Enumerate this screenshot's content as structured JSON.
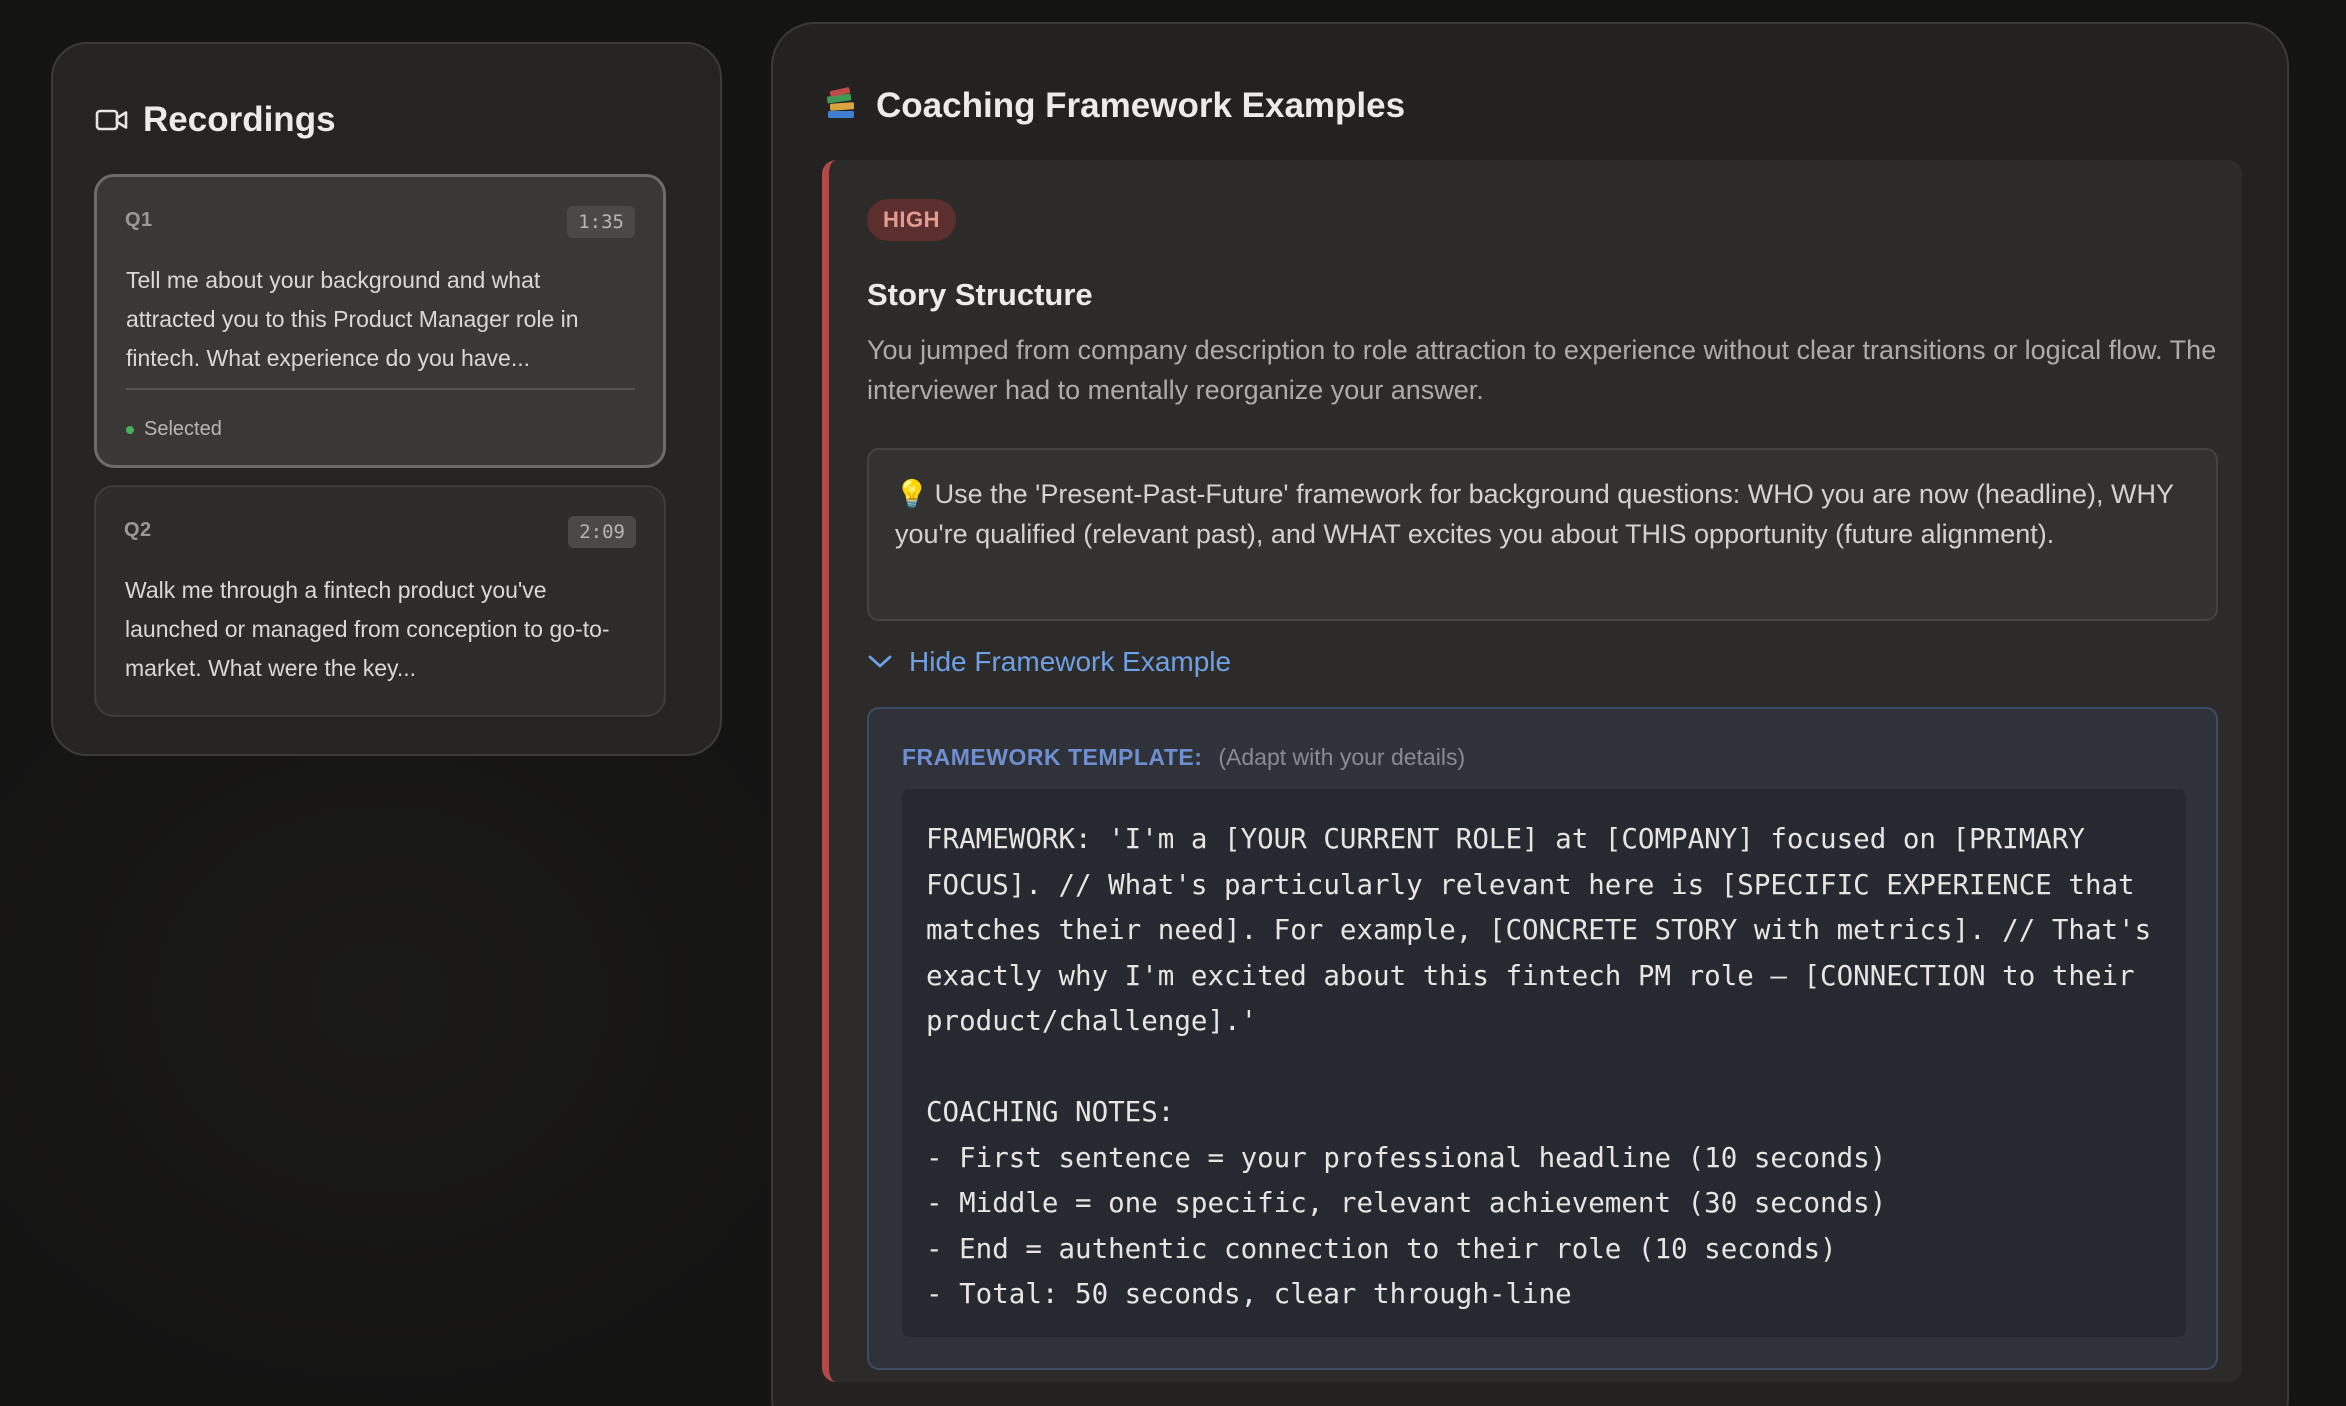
{
  "recordings": {
    "title": "Recordings",
    "icon": "video-camera-icon",
    "items": [
      {
        "label": "Q1",
        "duration": "1:35",
        "text": "Tell me about your background and what attracted you to this Product Manager role in fintech. What experience do you have...",
        "status": "Selected"
      },
      {
        "label": "Q2",
        "duration": "2:09",
        "text": "Walk me through a fintech product you've launched or managed from conception to go-to-market. What were the key..."
      }
    ]
  },
  "coaching": {
    "title": "Coaching Framework Examples",
    "icon": "books-icon",
    "feedback": {
      "severity": "HIGH",
      "severity_color": "#b04a4a",
      "title": "Story Structure",
      "description": "You jumped from company description to role attraction to experience without clear transitions or logical flow. The interviewer had to mentally reorganize your answer.",
      "tip": "Use the 'Present-Past-Future' framework for background questions: WHO you are now (headline), WHY you're qualified (relevant past), and WHAT excites you about THIS opportunity (future alignment).",
      "toggle_label": "Hide Framework Example",
      "framework_label": "FRAMEWORK TEMPLATE:",
      "framework_hint": "(Adapt with your details)",
      "framework_text": "FRAMEWORK: 'I'm a [YOUR CURRENT ROLE] at [COMPANY] focused on [PRIMARY FOCUS]. // What's particularly relevant here is [SPECIFIC EXPERIENCE that matches their need]. For example, [CONCRETE STORY with metrics]. // That's exactly why I'm excited about this fintech PM role — [CONNECTION to their product/challenge].'\n\nCOACHING NOTES:\n- First sentence = your professional headline (10 seconds)\n- Middle = one specific, relevant achievement (30 seconds)\n- End = authentic connection to their role (10 seconds)\n- Total: 50 seconds, clear through-line"
    }
  }
}
